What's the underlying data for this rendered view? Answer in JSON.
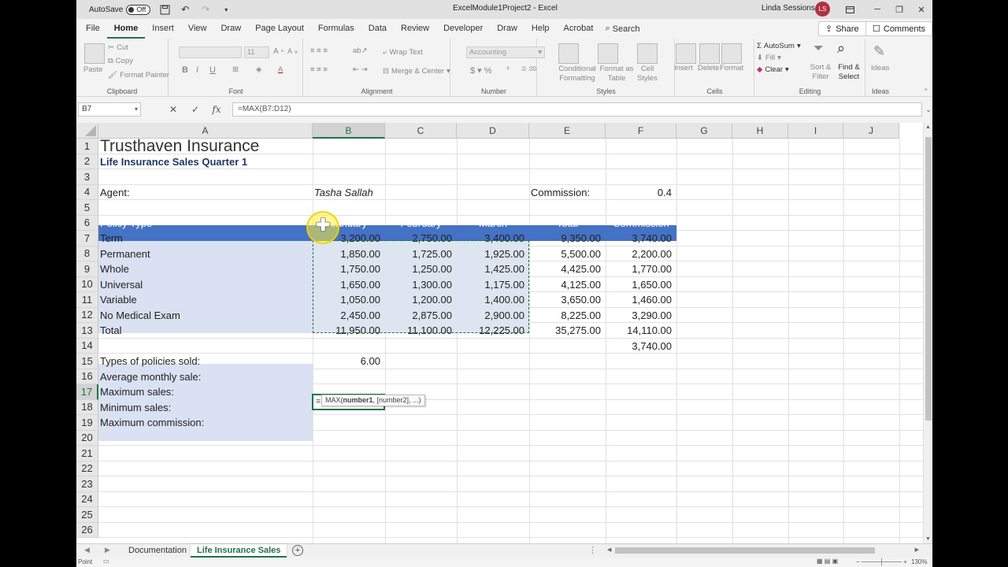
{
  "titlebar": {
    "autosave_label": "AutoSave",
    "autosave_state": "Off",
    "doc_title": "ExcelModule1Project2  -  Excel",
    "user_name": "Linda Sessions",
    "user_initials": "LS"
  },
  "tabs": [
    "File",
    "Home",
    "Insert",
    "View",
    "Draw",
    "Page Layout",
    "Formulas",
    "Data",
    "Review",
    "Developer",
    "Draw",
    "Help",
    "Acrobat"
  ],
  "active_tab": "Home",
  "search_label": "Search",
  "share_label": "Share",
  "comments_label": "Comments",
  "ribbon": {
    "clipboard": {
      "label": "Clipboard",
      "paste": "Paste",
      "cut": "Cut",
      "copy": "Copy",
      "format_painter": "Format Painter"
    },
    "font": {
      "label": "Font",
      "size": "11",
      "bold": "B",
      "italic": "I",
      "underline": "U"
    },
    "alignment": {
      "label": "Alignment",
      "wrap": "Wrap Text",
      "merge": "Merge & Center"
    },
    "number": {
      "label": "Number",
      "format": "Accounting"
    },
    "styles": {
      "label": "Styles",
      "cond": "Conditional Formatting",
      "format_table": "Format as Table",
      "cell_styles": "Cell Styles"
    },
    "cells": {
      "label": "Cells",
      "insert": "Insert",
      "delete": "Delete",
      "format": "Format"
    },
    "editing": {
      "label": "Editing",
      "autosum": "AutoSum",
      "fill": "Fill",
      "clear": "Clear",
      "sort": "Sort & Filter",
      "find": "Find & Select"
    },
    "ideas": {
      "label": "Ideas",
      "ideas": "Ideas"
    }
  },
  "formula_bar": {
    "name_box": "B7",
    "formula": "=MAX(B7:D12)",
    "cancel": "✕",
    "enter": "✓",
    "fx": "fx"
  },
  "columns": [
    "A",
    "B",
    "C",
    "D",
    "E",
    "F",
    "G",
    "H",
    "I",
    "J"
  ],
  "rows": [
    "1",
    "2",
    "3",
    "4",
    "5",
    "6",
    "7",
    "8",
    "9",
    "10",
    "11",
    "12",
    "13",
    "14",
    "15",
    "16",
    "17",
    "18",
    "19",
    "20",
    "21",
    "22",
    "23",
    "24",
    "25",
    "26"
  ],
  "sheet": {
    "title": "Trusthaven Insurance",
    "subtitle": "Life Insurance Sales Quarter 1",
    "agent_label": "Agent:",
    "agent_name": "Tasha Sallah",
    "commission_label": "Commission:",
    "commission_rate": "0.4",
    "header": [
      "Policy Type",
      "January",
      "February",
      "March",
      "Total",
      "Commission"
    ],
    "data_rows": [
      {
        "type": "Term",
        "jan": "3,200.00",
        "feb": "2,750.00",
        "mar": "3,400.00",
        "total": "9,350.00",
        "comm": "3,740.00"
      },
      {
        "type": "Permanent",
        "jan": "1,850.00",
        "feb": "1,725.00",
        "mar": "1,925.00",
        "total": "5,500.00",
        "comm": "2,200.00"
      },
      {
        "type": "Whole",
        "jan": "1,750.00",
        "feb": "1,250.00",
        "mar": "1,425.00",
        "total": "4,425.00",
        "comm": "1,770.00"
      },
      {
        "type": "Universal",
        "jan": "1,650.00",
        "feb": "1,300.00",
        "mar": "1,175.00",
        "total": "4,125.00",
        "comm": "1,650.00"
      },
      {
        "type": "Variable",
        "jan": "1,050.00",
        "feb": "1,200.00",
        "mar": "1,400.00",
        "total": "3,650.00",
        "comm": "1,460.00"
      },
      {
        "type": "No Medical Exam",
        "jan": "2,450.00",
        "feb": "2,875.00",
        "mar": "2,900.00",
        "total": "8,225.00",
        "comm": "3,290.00"
      }
    ],
    "total_row": {
      "type": "Total",
      "jan": "11,950.00",
      "feb": "11,100.00",
      "mar": "12,225.00",
      "total": "35,275.00",
      "comm": "14,110.00"
    },
    "f14": "3,740.00",
    "stats": [
      {
        "label": "Types of policies sold:",
        "value": "6.00"
      },
      {
        "label": "Average monthly sale:",
        "value": ""
      },
      {
        "label": "Maximum sales:",
        "value": "="
      },
      {
        "label": "Minimum sales:",
        "value": ""
      },
      {
        "label": "Maximum commission:",
        "value": ""
      }
    ],
    "tooltip_prefix": "MAX(",
    "tooltip_arg1": "number1",
    "tooltip_rest": ", [number2], ...)"
  },
  "sheet_tabs": [
    "Documentation",
    "Life Insurance Sales"
  ],
  "active_sheet": "Life Insurance Sales",
  "status": {
    "mode": "Point",
    "zoom": "130%"
  }
}
